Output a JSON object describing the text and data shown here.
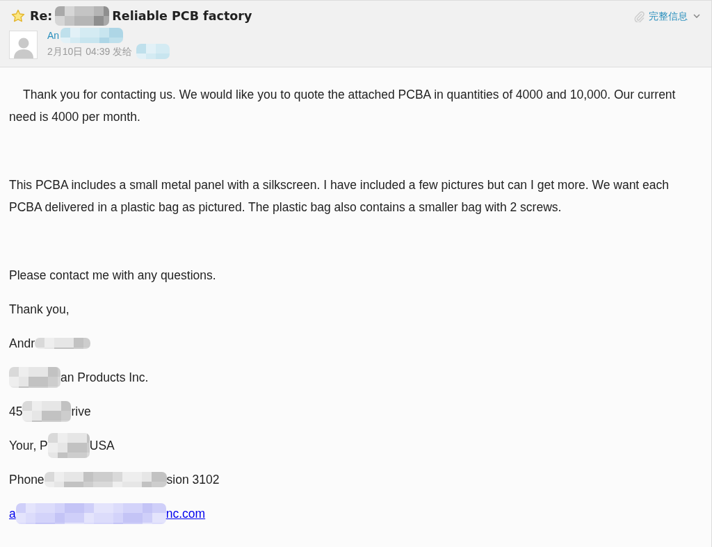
{
  "header": {
    "subject": [
      {
        "kind": "text",
        "text": "Re:"
      },
      {
        "kind": "redacted"
      },
      {
        "kind": "text",
        "text": "Reliable PCB factory"
      }
    ],
    "sender": [
      {
        "kind": "text",
        "text": "An"
      },
      {
        "kind": "redacted"
      }
    ],
    "meta": [
      {
        "kind": "text",
        "text": "2月10日 04:39 发给"
      },
      {
        "kind": "redacted"
      }
    ],
    "details_link": "完整信息"
  },
  "body": {
    "paragraphs": [
      {
        "text": "Thank you for contacting us. We would like you to quote the attached PCBA in quantities of 4000 and 10,000. Our current need is 4000 per month.",
        "indented": true
      },
      {
        "text": "This PCBA includes a small metal panel with a silkscreen. I have included a few pictures but can I get more. We want each PCBA delivered in a plastic bag as pictured. The plastic bag also contains a smaller bag with 2 screws.",
        "indented": false
      }
    ],
    "closing": [
      "Please contact me with any questions.",
      "Thank you,"
    ],
    "signature": [
      [
        {
          "kind": "text",
          "text": "Andr"
        },
        {
          "kind": "redacted"
        }
      ],
      [
        {
          "kind": "redacted"
        },
        {
          "kind": "text",
          "text": "an Products Inc."
        }
      ],
      [
        {
          "kind": "text",
          "text": "45"
        },
        {
          "kind": "redacted"
        },
        {
          "kind": "text",
          "text": "rive"
        }
      ],
      [
        {
          "kind": "text",
          "text": "Your, P"
        },
        {
          "kind": "redacted"
        },
        {
          "kind": "text",
          "text": "USA"
        }
      ],
      [
        {
          "kind": "text",
          "text": "Phone"
        },
        {
          "kind": "redacted"
        },
        {
          "kind": "text",
          "text": "sion 3102"
        }
      ],
      [
        {
          "kind": "link",
          "text": "a"
        },
        {
          "kind": "redacted"
        },
        {
          "kind": "link",
          "text": "nc.com"
        }
      ]
    ]
  }
}
